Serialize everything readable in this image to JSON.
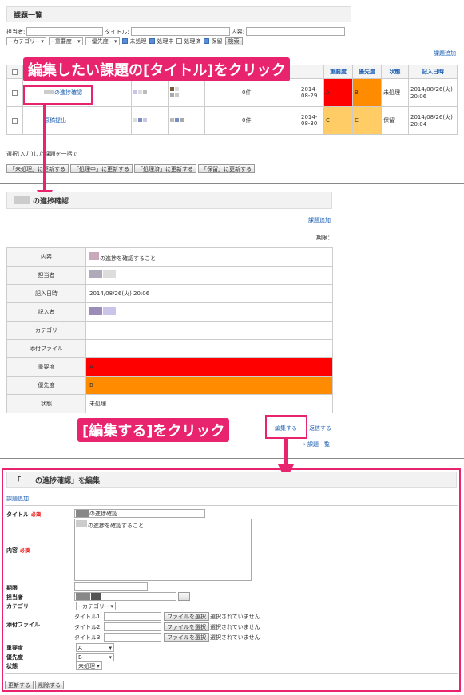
{
  "list": {
    "title": "課題一覧",
    "filters": {
      "assignee_label": "担当者:",
      "title_label": "タイトル:",
      "content_label": "内容:",
      "category": "--カテゴリ-- ▾",
      "importance": "--重要度-- ▾",
      "priority": "--優先度-- ▾",
      "statuses": [
        {
          "label": "未処理",
          "checked": true
        },
        {
          "label": "処理中",
          "checked": true
        },
        {
          "label": "処理済",
          "checked": false
        },
        {
          "label": "保留",
          "checked": true
        }
      ],
      "search_button": "検索"
    },
    "add_link": "課題追加",
    "columns": [
      "",
      "",
      "",
      "",
      "",
      "",
      "",
      "重要度",
      "優先度",
      "状態",
      "記入日時"
    ],
    "rows": [
      {
        "title": "の進捗確認",
        "count": "0件",
        "date": "2014-08-29",
        "importance": "A",
        "priority": "B",
        "status": "未処理",
        "written": "2014/08/26(火) 20:06",
        "imp_color": "#ff0000",
        "pri_color": "#ff8c00"
      },
      {
        "title": "原稿提出",
        "count": "0件",
        "date": "2014-08-30",
        "importance": "C",
        "priority": "C",
        "status": "保留",
        "written": "2014/08/26(火) 20:04",
        "imp_color": "#ffcc66",
        "pri_color": "#ffcc66"
      }
    ],
    "batch_label": "選択(入力)した課題を一括で",
    "batch_buttons": [
      "「未処理」に更新する",
      "「処理中」に更新する",
      "「処理済」に更新する",
      "「保留」に更新する"
    ]
  },
  "callouts": {
    "first": "編集したい課題の[タイトル]をクリック",
    "second": "[編集する]をクリック"
  },
  "detail": {
    "title": "の進捗確認",
    "add_link": "課題追加",
    "deadline_label": "期限：",
    "rows": [
      {
        "label": "内容",
        "value": "の進捗を確認すること"
      },
      {
        "label": "担当者",
        "value": ""
      },
      {
        "label": "記入日時",
        "value": "2014/08/26(火) 20:06"
      },
      {
        "label": "記入者",
        "value": ""
      },
      {
        "label": "カテゴリ",
        "value": ""
      },
      {
        "label": "添付ファイル",
        "value": ""
      },
      {
        "label": "重要度",
        "value": "A"
      },
      {
        "label": "優先度",
        "value": "B"
      },
      {
        "label": "状態",
        "value": "未処理"
      }
    ],
    "edit_link": "編集する",
    "reply_link": "返信する",
    "list_link": "› 課題一覧"
  },
  "edit": {
    "heading": "「　　の進捗確認」を編集",
    "add_link": "課題追加",
    "required": "必須",
    "labels": {
      "title": "タイトル",
      "content": "内容",
      "deadline": "期限",
      "assignee": "担当者",
      "category": "カテゴリ",
      "attachment": "添付ファイル",
      "importance": "重要度",
      "priority": "優先度",
      "status": "状態"
    },
    "title_value": "の進捗確認",
    "content_value": "の進捗を確認すること",
    "assignee_button": "...",
    "category_select": "--カテゴリ-- ▾",
    "files": [
      {
        "label": "タイトル1",
        "button": "ファイルを選択",
        "status": "選択されていません"
      },
      {
        "label": "タイトル2",
        "button": "ファイルを選択",
        "status": "選択されていません"
      },
      {
        "label": "タイトル3",
        "button": "ファイルを選択",
        "status": "選択されていません"
      }
    ],
    "importance_select": "A",
    "priority_select": "B",
    "status_select": "未処理 ▾",
    "update_button": "更新する",
    "delete_button": "削除する"
  }
}
